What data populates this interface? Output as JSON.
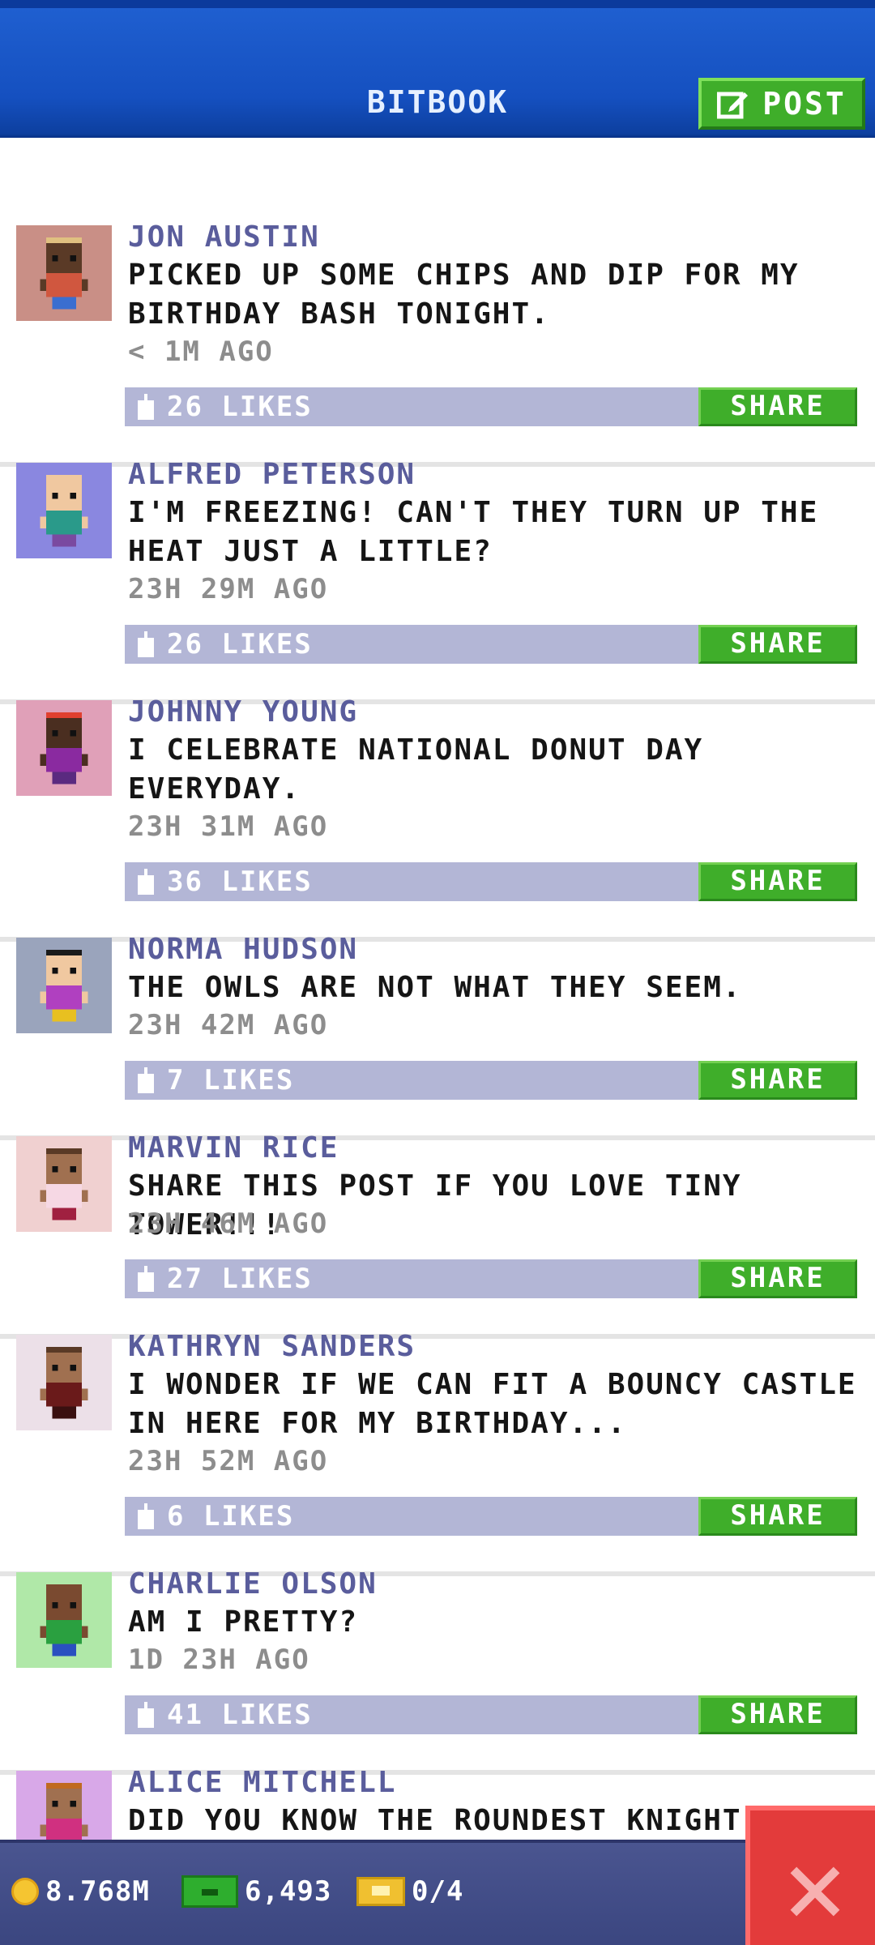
{
  "header": {
    "title": "BITBOOK",
    "post_label": "POST"
  },
  "posts": [
    {
      "name": "JON AUSTIN",
      "text": "PICKED UP SOME CHIPS AND DIP FOR MY BIRTHDAY BASH TONIGHT.",
      "time": "< 1M AGO",
      "likes": "26 LIKES",
      "share": "SHARE",
      "avatar_bg": "#c98f86",
      "skin": "#5a3a26",
      "hair": "#e0c080",
      "shirt": "#d0573f",
      "pants": "#3a6ed0"
    },
    {
      "name": "ALFRED PETERSON",
      "text": "I'M FREEZING! CAN'T THEY TURN UP THE HEAT JUST A LITTLE?",
      "time": "23H 29M AGO",
      "likes": "26 LIKES",
      "share": "SHARE",
      "avatar_bg": "#8a87e0",
      "skin": "#f0c8a0",
      "hair": "#f0c8a0",
      "shirt": "#2a9a8a",
      "pants": "#7a4aa0"
    },
    {
      "name": "JOHNNY YOUNG",
      "text": "I CELEBRATE NATIONAL DONUT DAY EVERYDAY.",
      "time": "23H 31M AGO",
      "likes": "36 LIKES",
      "share": "SHARE",
      "avatar_bg": "#e0a0b8",
      "skin": "#4a2e20",
      "hair": "#e04030",
      "shirt": "#8a2aa0",
      "pants": "#5a2a80"
    },
    {
      "name": "NORMA HUDSON",
      "text": "THE OWLS ARE NOT WHAT THEY SEEM.",
      "time": "23H 42M AGO",
      "likes": "7 LIKES",
      "share": "SHARE",
      "avatar_bg": "#9aa4bc",
      "skin": "#f0c8a0",
      "hair": "#1a1a1a",
      "shirt": "#b040c0",
      "pants": "#e8c020"
    },
    {
      "name": "MARVIN RICE",
      "text": "SHARE THIS POST IF YOU LOVE TINY TOWER!!!",
      "time": "23H 46M AGO",
      "likes": "27 LIKES",
      "share": "SHARE",
      "avatar_bg": "#f0d0d0",
      "skin": "#a07050",
      "hair": "#5a3a26",
      "shirt": "#f6d8e4",
      "pants": "#a02040"
    },
    {
      "name": "KATHRYN SANDERS",
      "text": "I WONDER IF WE CAN FIT A BOUNCY CASTLE IN HERE FOR MY BIRTHDAY...",
      "time": "23H 52M AGO",
      "likes": "6 LIKES",
      "share": "SHARE",
      "avatar_bg": "#ece0e8",
      "skin": "#a07050",
      "hair": "#5a3a26",
      "shirt": "#6a1a1a",
      "pants": "#3a1010"
    },
    {
      "name": "CHARLIE OLSON",
      "text": "AM I PRETTY?",
      "time": "1D 23H AGO",
      "likes": "41 LIKES",
      "share": "SHARE",
      "avatar_bg": "#b0e8a8",
      "skin": "#7a4a30",
      "hair": "#7a4a30",
      "shirt": "#2aa040",
      "pants": "#2a50c0"
    },
    {
      "name": "ALICE MITCHELL",
      "text": "DID YOU KNOW THE ROUNDEST KNIGHT",
      "time": "",
      "likes": "",
      "share": "",
      "avatar_bg": "#d8a8e8",
      "skin": "#a07050",
      "hair": "#c06a20",
      "shirt": "#d03080",
      "pants": "#d03080"
    }
  ],
  "status_bar": {
    "coins": "8.768M",
    "bux": "6,493",
    "tickets": "0/4"
  },
  "colors": {
    "header_blue": "#1550c0",
    "share_green": "#3fae2a",
    "like_bar": "#b3b6d6",
    "name_color": "#5a5d9c",
    "close_red": "#e33b3b"
  },
  "icons": [
    "edit-icon",
    "like-icon",
    "coin-icon",
    "bux-icon",
    "ticket-icon",
    "close-icon"
  ]
}
